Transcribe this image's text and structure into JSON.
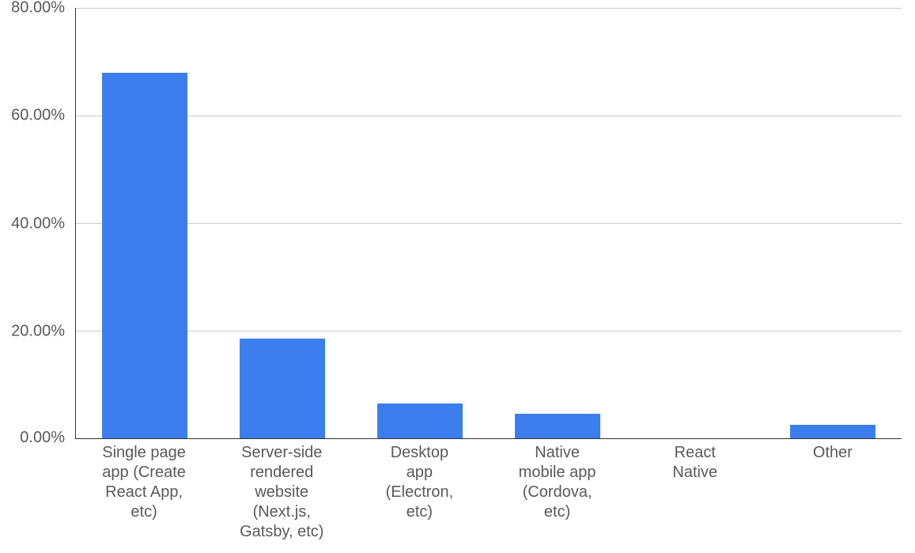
{
  "chart_data": {
    "type": "bar",
    "categories": [
      "Single page\napp (Create\nReact App,\netc)",
      "Server-side\nrendered\nwebsite\n(Next.js,\nGatsby, etc)",
      "Desktop\napp\n(Electron,\netc)",
      "Native\nmobile app\n(Cordova,\netc)",
      "React\nNative",
      "Other"
    ],
    "values": [
      68.0,
      18.5,
      6.5,
      4.5,
      0.0,
      2.5
    ],
    "y_ticks": [
      "0.00%",
      "20.00%",
      "40.00%",
      "60.00%",
      "80.00%"
    ],
    "ylim": [
      0,
      80
    ],
    "bar_color": "#3b7ded",
    "grid_color": "#cccccc",
    "axis_color": "#333333",
    "title": "",
    "xlabel": "",
    "ylabel": ""
  }
}
